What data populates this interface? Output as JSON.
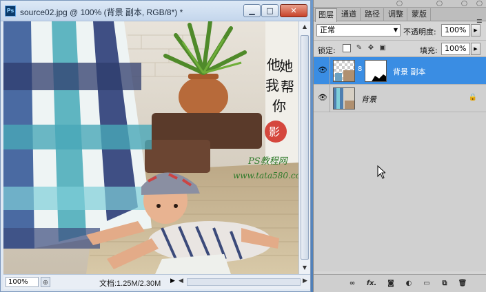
{
  "document": {
    "app_icon": "Ps",
    "title": "source02.jpg @ 100% (背景 副本, RGB/8*) *",
    "window_buttons": {
      "minimize": "▁",
      "maximize": "□",
      "close": "✕"
    },
    "zoom": "100%",
    "doc_info": "文档:1.25M/2.30M",
    "image_text": {
      "handwriting": [
        "他",
        "她",
        "我",
        "帮",
        "你"
      ],
      "seal": "影",
      "site_name": "PS教程网",
      "site_url": "www.tata580.com"
    }
  },
  "layers_panel": {
    "tabs": [
      "图层",
      "通道",
      "路径",
      "调整",
      "蒙版"
    ],
    "active_tab": "图层",
    "blend_mode": "正常",
    "opacity_label": "不透明度:",
    "opacity": "100%",
    "lock_label": "锁定:",
    "fill_label": "填充:",
    "fill": "100%",
    "layers": [
      {
        "name": "背景 副本",
        "selected": true,
        "visible": true,
        "has_mask": true
      },
      {
        "name": "背景",
        "selected": false,
        "visible": true,
        "locked": true
      }
    ],
    "bottom_icons": [
      "link-icon",
      "fx-icon",
      "mask-icon",
      "adjustment-icon",
      "group-icon",
      "new-layer-icon",
      "trash-icon"
    ],
    "bottom_labels": {
      "fx": "fx."
    }
  },
  "colors": {
    "selected_layer": "#3a8de3",
    "titlebar": "#c4d6ec",
    "panel_bg": "#d6d6d6"
  }
}
